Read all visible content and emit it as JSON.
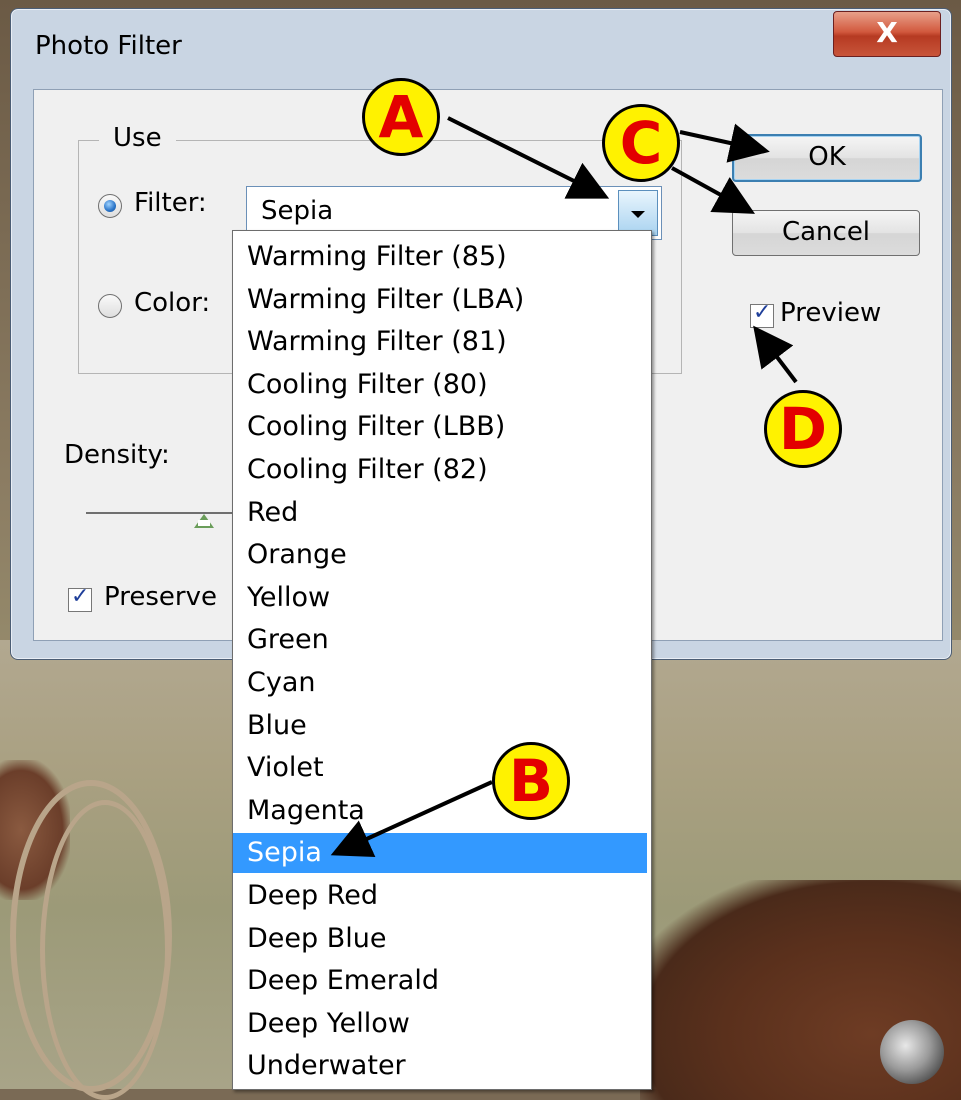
{
  "window": {
    "title": "Photo Filter",
    "close_glyph": "X"
  },
  "use_group": {
    "legend": "Use",
    "filter_label": "Filter:",
    "filter_selected": true,
    "color_label": "Color:",
    "color_selected": false
  },
  "filter_combo": {
    "value": "Sepia"
  },
  "buttons": {
    "ok": "OK",
    "cancel": "Cancel"
  },
  "preview": {
    "label": "Preview",
    "checked": true
  },
  "density": {
    "label": "Density:"
  },
  "preserve": {
    "label": "Preserve",
    "checked": true
  },
  "dropdown": {
    "options": [
      "Warming Filter (85)",
      "Warming Filter (LBA)",
      "Warming Filter (81)",
      "Cooling Filter (80)",
      "Cooling Filter (LBB)",
      "Cooling Filter (82)",
      "Red",
      "Orange",
      "Yellow",
      "Green",
      "Cyan",
      "Blue",
      "Violet",
      "Magenta",
      "Sepia",
      "Deep Red",
      "Deep Blue",
      "Deep Emerald",
      "Deep Yellow",
      "Underwater"
    ],
    "selected": "Sepia"
  },
  "callouts": {
    "a": "A",
    "b": "B",
    "c": "C",
    "d": "D"
  },
  "colors": {
    "highlight": "#3399ff",
    "callout_fill": "#fff200",
    "callout_text": "#e30000"
  }
}
